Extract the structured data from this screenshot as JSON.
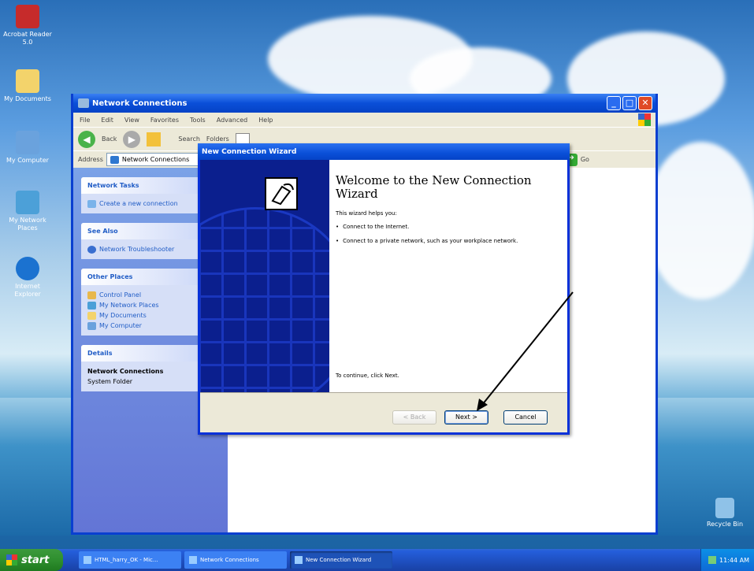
{
  "desktop": {
    "icons": [
      {
        "label": "Acrobat Reader 5.0",
        "color": "#c62b2b"
      },
      {
        "label": "My Documents",
        "color": "#f3d36b"
      },
      {
        "label": "My Computer",
        "color": "#6aa2dd"
      },
      {
        "label": "My Network Places",
        "color": "#4ca0d8"
      },
      {
        "label": "Internet Explorer",
        "color": "#1b72d0"
      }
    ],
    "recycle_label": "Recycle Bin"
  },
  "explorer": {
    "title": "Network Connections",
    "menu": [
      "File",
      "Edit",
      "View",
      "Favorites",
      "Tools",
      "Advanced",
      "Help"
    ],
    "toolbar": {
      "back": "Back",
      "search": "Search",
      "folders": "Folders"
    },
    "address_label": "Address",
    "address_value": "Network Connections",
    "go_label": "Go",
    "panels": {
      "network_tasks": {
        "title": "Network Tasks",
        "items": [
          "Create a new connection"
        ]
      },
      "see_also": {
        "title": "See Also",
        "items": [
          "Network Troubleshooter"
        ]
      },
      "other_places": {
        "title": "Other Places",
        "items": [
          "Control Panel",
          "My Network Places",
          "My Documents",
          "My Computer"
        ]
      },
      "details": {
        "title": "Details",
        "name": "Network Connections",
        "type": "System Folder"
      }
    }
  },
  "wizard": {
    "title": "New Connection Wizard",
    "heading": "Welcome to the New Connection Wizard",
    "intro": "This wizard helps you:",
    "bullets": [
      "Connect to the Internet.",
      "Connect to a private network, such as your workplace network."
    ],
    "continue_text": "To continue, click Next.",
    "buttons": {
      "back": "< Back",
      "next": "Next >",
      "cancel": "Cancel"
    }
  },
  "taskbar": {
    "start_label": "start",
    "tasks": [
      "HTML_harry_OK - Mic...",
      "Network Connections",
      "New Connection Wizard"
    ],
    "clock": "11:44 AM"
  },
  "colors": {
    "xp_blue": "#0a4fd8",
    "start_green": "#2f8f2f",
    "wizard_panel": "#0b1f8e"
  }
}
